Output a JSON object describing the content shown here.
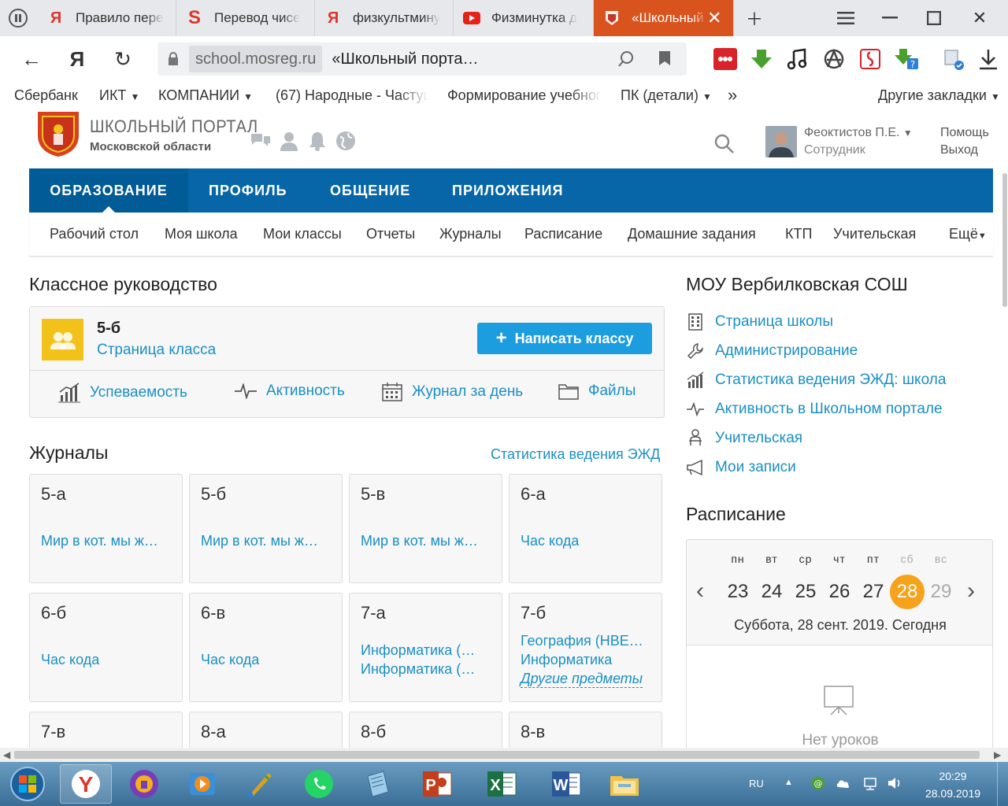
{
  "browser": {
    "tabs": [
      {
        "label": "Правило пере",
        "icon": "yandex-icon"
      },
      {
        "label": "Перевод чисе",
        "icon": "s-icon"
      },
      {
        "label": "физкультмину",
        "icon": "yandex-icon"
      },
      {
        "label": "Физминутка д",
        "icon": "youtube-icon"
      },
      {
        "label": "«Школьный",
        "icon": "portal-icon",
        "active": true
      }
    ],
    "address_host": "school.mosreg.ru",
    "address_title": "«Школьный порта…",
    "bookmarks": [
      "Сбербанк",
      "ИКТ",
      "КОМПАНИИ",
      "(67) Народные - Частуш",
      "Формирование учебного",
      "ПК (детали)",
      "»",
      "Другие закладки"
    ],
    "accent": "#d9531e"
  },
  "portal": {
    "logo_title": "ШКОЛЬНЫЙ ПОРТАЛ",
    "logo_subtitle": "Московской области",
    "user_name": "Феоктистов П.Е.",
    "user_role": "Сотрудник",
    "help": "Помощь",
    "logout": "Выход",
    "main_nav": [
      "ОБРАЗОВАНИЕ",
      "ПРОФИЛЬ",
      "ОБЩЕНИЕ",
      "ПРИЛОЖЕНИЯ"
    ],
    "sub_nav": [
      "Рабочий стол",
      "Моя школа",
      "Мои классы",
      "Отчеты",
      "Журналы",
      "Расписание",
      "Домашние задания",
      "КТП",
      "Учительская",
      "Ещё"
    ],
    "nav_color": "#0766a7"
  },
  "class_section": {
    "title": "Классное руководство",
    "class_name": "5-б",
    "class_page": "Страница класса",
    "write_button": "Написать классу",
    "links": [
      "Успеваемость",
      "Активность",
      "Журнал за день",
      "Файлы"
    ]
  },
  "journals": {
    "title": "Журналы",
    "stats_link": "Статистика ведения ЭЖД",
    "tiles": [
      {
        "class": "5-а",
        "subjects": [
          "Мир в кот. мы ж…"
        ]
      },
      {
        "class": "5-б",
        "subjects": [
          "Мир в кот. мы ж…"
        ]
      },
      {
        "class": "5-в",
        "subjects": [
          "Мир в кот. мы ж…"
        ]
      },
      {
        "class": "6-а",
        "subjects": [
          "Час кода"
        ]
      },
      {
        "class": "6-б",
        "subjects": [
          "Час кода"
        ]
      },
      {
        "class": "6-в",
        "subjects": [
          "Час кода"
        ]
      },
      {
        "class": "7-а",
        "subjects": [
          "Информатика (…",
          "Информатика (…"
        ]
      },
      {
        "class": "7-б",
        "subjects": [
          "География (НВЕ…",
          "Информатика"
        ],
        "other": "Другие предметы"
      },
      {
        "class": "7-в",
        "subjects": []
      },
      {
        "class": "8-а",
        "subjects": []
      },
      {
        "class": "8-б",
        "subjects": []
      },
      {
        "class": "8-в",
        "subjects": []
      }
    ]
  },
  "school": {
    "name": "МОУ Вербилковская СОШ",
    "links": [
      {
        "label": "Страница школы",
        "icon": "building-icon"
      },
      {
        "label": "Администрирование",
        "icon": "wrench-icon"
      },
      {
        "label": "Статистика ведения ЭЖД: школа",
        "icon": "bar-chart-icon"
      },
      {
        "label": "Активность в Школьном портале",
        "icon": "pulse-icon"
      },
      {
        "label": "Учительская",
        "icon": "teacher-icon"
      },
      {
        "label": "Мои записи",
        "icon": "megaphone-icon"
      }
    ]
  },
  "schedule": {
    "title": "Расписание",
    "weekdays": [
      "пн",
      "вт",
      "ср",
      "чт",
      "пт",
      "сб",
      "вс"
    ],
    "days": [
      "23",
      "24",
      "25",
      "26",
      "27",
      "28",
      "29"
    ],
    "today_index": 5,
    "today_text": "Суббота, 28 сент. 2019. Сегодня",
    "no_lessons": "Нет уроков",
    "today_color": "#f7a21b"
  },
  "taskbar": {
    "lang": "RU",
    "time": "20:29",
    "date": "28.09.2019"
  }
}
